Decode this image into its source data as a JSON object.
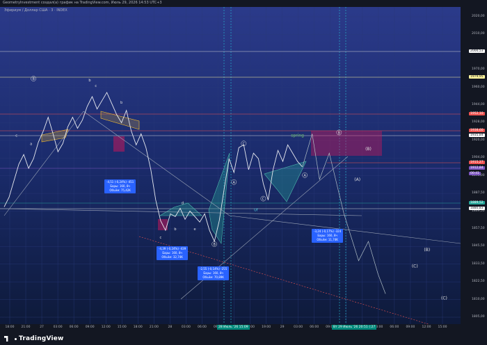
{
  "header": {
    "title": "GeometryInvestment создал(а) график на TradingView.com, Июль 29, 2026 14:53 UTC+3"
  },
  "symbol": {
    "label": "Эфириум / Доллар США · 3 · INDEX"
  },
  "footer": {
    "logo_text": "TradingView"
  },
  "colors": {
    "background": "#131722",
    "price_line": "#e8e8e8",
    "blue_box": "#2962ff",
    "red_zone": "#c2185b",
    "green_wedge": "#26a69a"
  },
  "chart_data": {
    "type": "line",
    "ylim": [
      1800,
      2030
    ],
    "price_ticks": [
      "2020,00",
      "2010,00",
      "1990,00",
      "1970,00",
      "1960,00",
      "1944,00",
      "1928,00",
      "1920,00",
      "1904,00",
      "1896,00",
      "1887,50",
      "1869,50",
      "1857,50",
      "1845,50",
      "1833,50",
      "1822,50",
      "1810,00",
      "1805,00"
    ],
    "time_ticks": [
      "18:00",
      "21:00",
      "27",
      "03:00",
      "06:00",
      "09:00",
      "12:00",
      "15:00",
      "18:00",
      "21:00",
      "28",
      "03:00",
      "06:00",
      "09:00",
      "12:00",
      "15:00",
      "19:00",
      "29",
      "03:00",
      "06:00",
      "09:00",
      "12:00",
      "15:00",
      "03:00",
      "06:00",
      "09:00",
      "12:00",
      "15:00"
    ],
    "time_markers": [
      "28 Июль '26   15:09",
      "Вт 29 Июль '26   20:51   (:27"
    ],
    "price_labels": [
      {
        "text": "2000,53",
        "kind": "white"
      },
      {
        "text": "1979,95",
        "kind": "yellow"
      },
      {
        "text": "1952,10",
        "kind": "red"
      },
      {
        "text": "1938,60",
        "kind": "red"
      },
      {
        "text": "1935,84",
        "kind": "white"
      },
      {
        "text": "1915,27",
        "kind": "red"
      },
      {
        "text": "1912,84",
        "kind": "purple"
      },
      {
        "text": "00:41",
        "kind": "purple"
      },
      {
        "text": "1889,52",
        "kind": "green"
      },
      {
        "text": "1880,83",
        "kind": "white"
      }
    ],
    "series": [
      {
        "values": [
          [
            0,
            1885
          ],
          [
            4,
            1892
          ],
          [
            8,
            1904
          ],
          [
            12,
            1916
          ],
          [
            16,
            1923
          ],
          [
            20,
            1913
          ],
          [
            24,
            1920
          ],
          [
            28,
            1932
          ],
          [
            32,
            1940
          ],
          [
            36,
            1950
          ],
          [
            40,
            1938
          ],
          [
            44,
            1925
          ],
          [
            48,
            1931
          ],
          [
            52,
            1943
          ],
          [
            56,
            1950
          ],
          [
            60,
            1942
          ],
          [
            64,
            1948
          ],
          [
            68,
            1958
          ],
          [
            72,
            1965
          ],
          [
            76,
            1956
          ],
          [
            80,
            1962
          ],
          [
            84,
            1968
          ],
          [
            88,
            1960
          ],
          [
            92,
            1952
          ],
          [
            96,
            1946
          ],
          [
            100,
            1955
          ],
          [
            104,
            1940
          ],
          [
            108,
            1930
          ],
          [
            112,
            1938
          ],
          [
            116,
            1928
          ],
          [
            120,
            1912
          ],
          [
            124,
            1890
          ],
          [
            128,
            1875
          ],
          [
            132,
            1868
          ],
          [
            136,
            1880
          ],
          [
            140,
            1878
          ],
          [
            144,
            1884
          ],
          [
            148,
            1876
          ],
          [
            152,
            1882
          ],
          [
            156,
            1878
          ],
          [
            160,
            1874
          ],
          [
            164,
            1880
          ],
          [
            168,
            1868
          ],
          [
            172,
            1860
          ],
          [
            176,
            1875
          ],
          [
            180,
            1898
          ],
          [
            184,
            1920
          ],
          [
            188,
            1910
          ],
          [
            192,
            1928
          ],
          [
            196,
            1930
          ],
          [
            200,
            1912
          ],
          [
            204,
            1924
          ],
          [
            208,
            1920
          ],
          [
            212,
            1902
          ],
          [
            216,
            1890
          ],
          [
            220,
            1912
          ],
          [
            224,
            1926
          ],
          [
            228,
            1918
          ],
          [
            232,
            1930
          ],
          [
            236,
            1924
          ],
          [
            240,
            1918
          ],
          [
            244,
            1914
          ]
        ]
      }
    ],
    "projection": [
      [
        244,
        1914
      ],
      [
        252,
        1938
      ],
      [
        258,
        1905
      ],
      [
        266,
        1924
      ],
      [
        278,
        1880
      ],
      [
        290,
        1846
      ],
      [
        298,
        1860
      ],
      [
        306,
        1836
      ],
      [
        312,
        1822
      ]
    ],
    "wave_labels": [
      {
        "text": "B",
        "x": 24,
        "y": 1977
      },
      {
        "text": "b",
        "x": 70,
        "y": 1976
      },
      {
        "text": "b",
        "x": 96,
        "y": 1960
      },
      {
        "text": "c",
        "x": 75,
        "y": 1972
      },
      {
        "text": "a",
        "x": 22,
        "y": 1930
      },
      {
        "text": "c",
        "x": 10,
        "y": 1936
      },
      {
        "text": "d",
        "x": 146,
        "y": 1887
      },
      {
        "text": "e",
        "x": 156,
        "y": 1868
      },
      {
        "text": "c",
        "x": 128,
        "y": 1862
      },
      {
        "text": "b",
        "x": 140,
        "y": 1868
      },
      {
        "text": "B",
        "x": 172,
        "y": 1857
      },
      {
        "text": "C",
        "x": 196,
        "y": 1930
      },
      {
        "text": "A",
        "x": 188,
        "y": 1902
      },
      {
        "text": "C",
        "x": 212,
        "y": 1890
      },
      {
        "text": "Uf",
        "x": 206,
        "y": 1882
      },
      {
        "text": "spring",
        "x": 240,
        "y": 1936
      },
      {
        "text": "A",
        "x": 246,
        "y": 1907
      },
      {
        "text": "B",
        "x": 274,
        "y": 1938
      },
      {
        "text": "(B)",
        "x": 298,
        "y": 1926
      },
      {
        "text": "(A)",
        "x": 289,
        "y": 1904
      },
      {
        "text": "(B)",
        "x": 346,
        "y": 1853
      },
      {
        "text": "(C)",
        "x": 336,
        "y": 1841
      },
      {
        "text": "(C)",
        "x": 360,
        "y": 1818
      }
    ],
    "info_boxes": [
      {
        "lines": [
          "-4,51 (-0,24%) -451",
          "Бары: 160, 8ч",
          "Объём: 75,42K"
        ]
      },
      {
        "lines": [
          "-4,39 (-0,24%) -439",
          "Бары: 160, 8ч",
          "Объём: 32,74K"
        ]
      },
      {
        "lines": [
          "-2,55 (-0,14%) -255",
          "Бары: 160, 8ч",
          "Объём: 70,89K"
        ]
      },
      {
        "lines": [
          "-3,24 (-0,17%) -324",
          "Бары: 160, 8ч",
          "Объём: 11,74K"
        ]
      }
    ]
  }
}
